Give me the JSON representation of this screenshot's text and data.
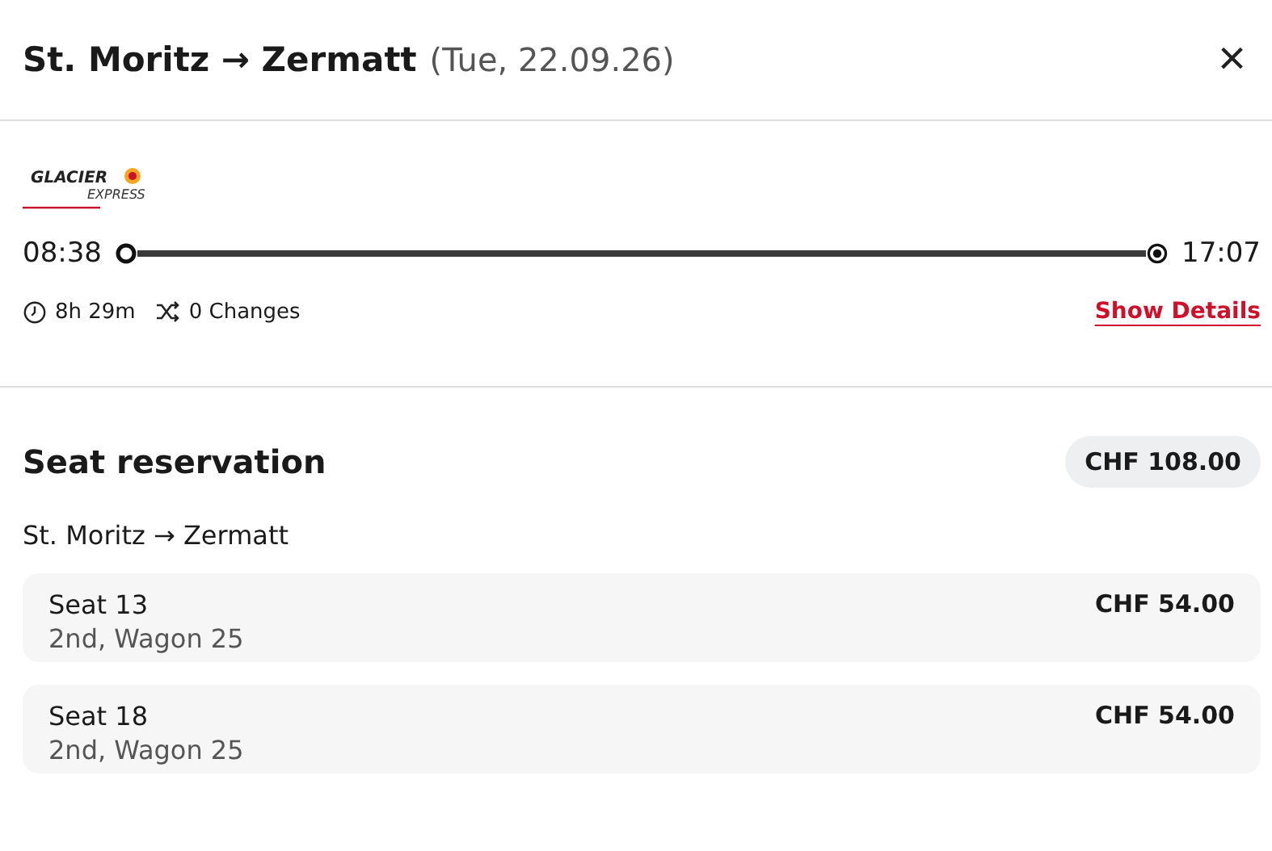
{
  "header": {
    "title": "St. Moritz → Zermatt",
    "date": "(Tue, 22.09.26)",
    "close": "×"
  },
  "connection": {
    "logo": {
      "line1": "GLACIER",
      "line2": "EXPRESS"
    },
    "departure": "08:38",
    "arrival": "17:07",
    "duration": "8h 29m",
    "changes": "0 Changes",
    "details_link": "Show Details"
  },
  "reservation": {
    "title": "Seat reservation",
    "total": "CHF 108.00",
    "route": "St. Moritz → Zermatt",
    "seats": [
      {
        "seat": "Seat 13",
        "info": "2nd, Wagon 25",
        "price": "CHF 54.00"
      },
      {
        "seat": "Seat 18",
        "info": "2nd, Wagon 25",
        "price": "CHF 54.00"
      }
    ]
  }
}
